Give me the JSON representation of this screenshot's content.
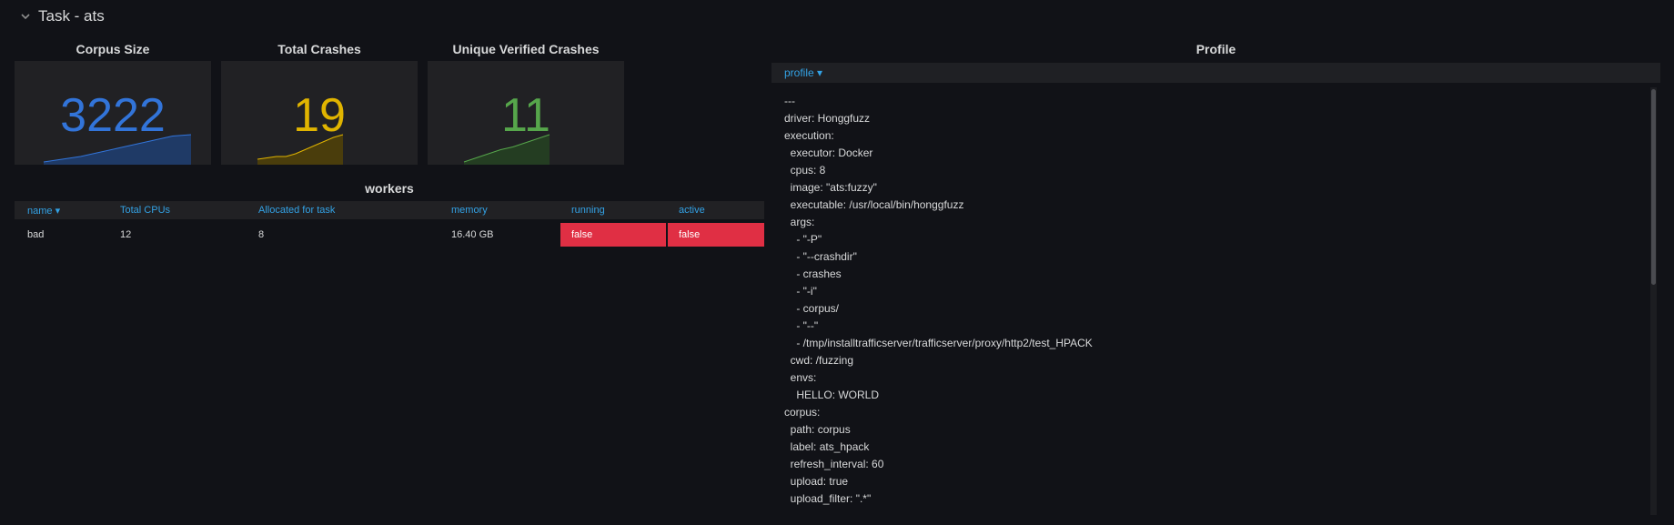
{
  "row": {
    "title": "Task - ats"
  },
  "stats": [
    {
      "title": "Corpus Size",
      "value": "3222",
      "color": "#3274d9",
      "fill": "#1f3a66",
      "spark": [
        0.0,
        0.1,
        0.2,
        0.35,
        0.5,
        0.65,
        0.8,
        0.95,
        1.0
      ]
    },
    {
      "title": "Total Crashes",
      "value": "19",
      "color": "#e0b400",
      "fill": "#4a3d0c",
      "spark": [
        0.1,
        0.15,
        0.2,
        0.2,
        0.3,
        0.45,
        0.6,
        0.75,
        0.9,
        1.0
      ]
    },
    {
      "title": "Unique Verified Crashes",
      "value": "11",
      "color": "#56a64b",
      "fill": "#243d22",
      "spark": [
        0.0,
        0.15,
        0.3,
        0.45,
        0.55,
        0.7,
        0.85,
        1.0
      ]
    }
  ],
  "workers": {
    "title": "workers",
    "headers": [
      "name",
      "Total CPUs",
      "Allocated for task",
      "memory",
      "running",
      "active"
    ],
    "sort_indicator": "▾",
    "rows": [
      {
        "name": "bad",
        "cpus": "12",
        "allocated": "8",
        "memory": "16.40 GB",
        "running": "false",
        "active": "false"
      }
    ]
  },
  "profile": {
    "title": "Profile",
    "selector": "profile",
    "selector_caret": "▾",
    "text": "---\ndriver: Honggfuzz\nexecution:\n  executor: Docker\n  cpus: 8\n  image: \"ats:fuzzy\"\n  executable: /usr/local/bin/honggfuzz\n  args:\n    - \"-P\"\n    - \"--crashdir\"\n    - crashes\n    - \"-i\"\n    - corpus/\n    - \"--\"\n    - /tmp/installtrafficserver/trafficserver/proxy/http2/test_HPACK\n  cwd: /fuzzing\n  envs:\n    HELLO: WORLD\ncorpus:\n  path: corpus\n  label: ats_hpack\n  refresh_interval: 60\n  upload: true\n  upload_filter: \".*\""
  }
}
